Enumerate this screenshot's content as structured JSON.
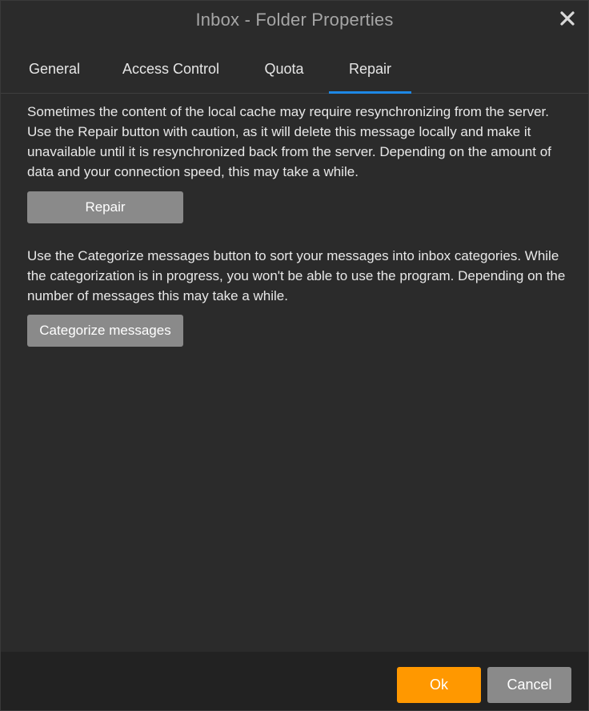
{
  "window": {
    "title": "Inbox - Folder Properties",
    "close_icon": "close-icon"
  },
  "tabs": [
    {
      "label": "General",
      "active": false
    },
    {
      "label": "Access Control",
      "active": false
    },
    {
      "label": "Quota",
      "active": false
    },
    {
      "label": "Repair",
      "active": true
    }
  ],
  "repair": {
    "description": "Sometimes the content of the local cache may require resynchronizing from the server. Use the Repair button with caution, as it will delete this message locally and make it unavailable until it is resynchronized back from the server. Depending on the amount of data and your connection speed, this may take a while.",
    "button_label": "Repair"
  },
  "categorize": {
    "description": "Use the Categorize messages button to sort your messages into inbox categories. While the categorization is in progress, you won't be able to use the program. Depending on the number of messages this may take a while.",
    "button_label": "Categorize messages"
  },
  "footer": {
    "ok_label": "Ok",
    "cancel_label": "Cancel"
  },
  "colors": {
    "background": "#2b2b2b",
    "footer_background": "#222222",
    "accent_tab": "#1e88e5",
    "ok_button": "#ff9800",
    "gray_button": "#8a8a8a"
  }
}
